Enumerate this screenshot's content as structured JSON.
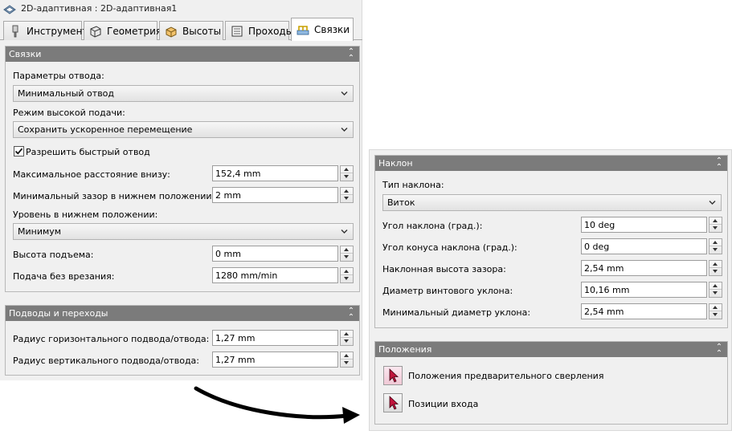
{
  "window": {
    "title": "2D-адаптивная : 2D-адаптивная1"
  },
  "tabs": [
    {
      "label": "Инструмент",
      "icon": "tool-icon"
    },
    {
      "label": "Геометрия",
      "icon": "geometry-icon"
    },
    {
      "label": "Высоты",
      "icon": "heights-icon"
    },
    {
      "label": "Проходы",
      "icon": "passes-icon"
    },
    {
      "label": "Связки",
      "icon": "linking-icon",
      "active": true
    }
  ],
  "linking": {
    "header": "Связки",
    "retract_params_label": "Параметры отвода:",
    "retract_params_value": "Минимальный отвод",
    "high_feed_label": "Режим высокой подачи:",
    "high_feed_value": "Сохранить ускоренное перемещение",
    "allow_rapid_label": "Разрешить быстрый отвод",
    "allow_rapid_checked": true,
    "max_stay_down_label": "Максимальное расстояние внизу:",
    "max_stay_down_value": "152,4 mm",
    "min_clearance_label": "Минимальный зазор в нижнем положении:",
    "min_clearance_value": "2 mm",
    "stay_down_level_label": "Уровень в нижнем положении:",
    "stay_down_level_value": "Минимум",
    "lift_height_label": "Высота подъема:",
    "lift_height_value": "0 mm",
    "no_engage_feed_label": "Подача без врезания:",
    "no_engage_feed_value": "1280 mm/min"
  },
  "leads": {
    "header": "Подводы и переходы",
    "horiz_radius_label": "Радиус горизонтального подвода/отвода:",
    "horiz_radius_value": "1,27 mm",
    "vert_radius_label": "Радиус вертикального подвода/отвода:",
    "vert_radius_value": "1,27 mm"
  },
  "ramp": {
    "header": "Наклон",
    "ramp_type_label": "Тип наклона:",
    "ramp_type_value": "Виток",
    "ramp_angle_label": "Угол наклона (град.):",
    "ramp_angle_value": "10 deg",
    "ramp_taper_label": "Угол конуса наклона (град.):",
    "ramp_taper_value": "0 deg",
    "ramp_clearance_label": "Наклонная высота зазора:",
    "ramp_clearance_value": "2,54 mm",
    "helix_diameter_label": "Диаметр винтового уклона:",
    "helix_diameter_value": "10,16 mm",
    "min_ramp_diameter_label": "Минимальный диаметр уклона:",
    "min_ramp_diameter_value": "2,54 mm"
  },
  "positions": {
    "header": "Положения",
    "predrill_label": "Положения предварительного сверления",
    "entry_label": "Позиции входа"
  },
  "colors": {
    "group_header": "#7b7b7b",
    "dialog_bg": "#f0f0f0",
    "arrow": "#000000"
  }
}
